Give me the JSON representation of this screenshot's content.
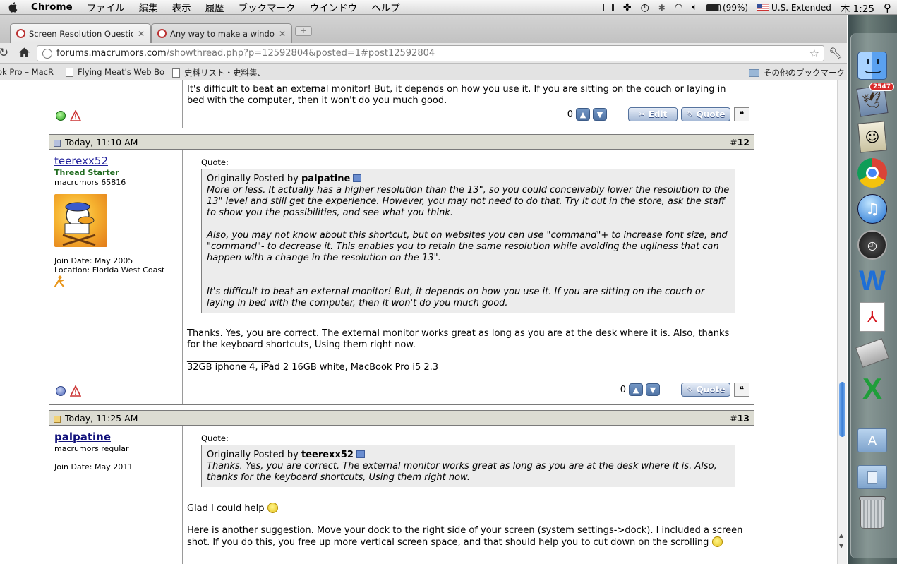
{
  "menubar": {
    "app": "Chrome",
    "items": [
      "ファイル",
      "編集",
      "表示",
      "履歴",
      "ブックマーク",
      "ウインドウ",
      "ヘルプ"
    ],
    "battery": "(99%)",
    "input_source": "U.S. Extended",
    "clock": "木 1:25"
  },
  "tabs": [
    {
      "title": "Screen Resolution Question -",
      "close": "✕"
    },
    {
      "title": "Any way to make a window f",
      "close": "✕"
    }
  ],
  "newtab": "+",
  "address": {
    "domain": "forums.macrumors.com",
    "path": "/showthread.php?p=12592804&posted=1#post12592804"
  },
  "bookmarks": {
    "items": [
      "ok Pro – MacR",
      "Flying Meat's Web Bo",
      "史料リスト・史料集、"
    ],
    "other": "その他のブックマーク"
  },
  "post_prev": {
    "tail_text_1": "It's difficult to beat an external monitor! But, it depends on how you use it. If you are sitting on the couch or laying in",
    "tail_text_2": "bed with the computer, then it won't do you much good.",
    "rep": "0",
    "edit": "Edit",
    "quote": "Quote"
  },
  "post12": {
    "date": "Today, 11:10 AM",
    "number_prefix": "#",
    "number": "12",
    "username": "teerexx52",
    "status": "Thread Starter",
    "rank": "macrumors 65816",
    "join": "Join Date: May 2005",
    "location": "Location: Florida West Coast",
    "quote_label": "Quote:",
    "quote_by_prefix": "Originally Posted by",
    "quote_author": "palpatine",
    "quote_p1": "More or less. It actually has a higher resolution than the 13\", so you could conceivably lower the resolution to the 13\" level and still get the experience. However, you may not need to do that. Try it out in the store, ask the staff to show you the possibilities, and see what you think.",
    "quote_p2": "Also, you may not know about this shortcut, but on websites you can use \"command\"+ to increase font size, and \"command\"- to decrease it. This enables you to retain the same resolution while avoiding the ugliness that can happen with a change in the resolution on the 13\".",
    "quote_p3": "It's difficult to beat an external monitor! But, it depends on how you use it. If you are sitting on the couch or laying in bed with the computer, then it won't do you much good.",
    "body": "Thanks. Yes, you are correct. The external monitor works great as long as you are at the desk where it is. Also, thanks for the keyboard shortcuts, Using them right now.",
    "signature_rule": "__________________",
    "signature": "32GB iphone 4, iPad 2 16GB white, MacBook Pro i5 2.3",
    "rep": "0",
    "quote": "Quote"
  },
  "post13": {
    "date": "Today, 11:25 AM",
    "number_prefix": "#",
    "number": "13",
    "username": "palpatine",
    "rank": "macrumors regular",
    "join": "Join Date: May 2011",
    "quote_label": "Quote:",
    "quote_by_prefix": "Originally Posted by",
    "quote_author": "teerexx52",
    "quote_p1": "Thanks. Yes, you are correct. The external monitor works great as long as you are at the desk where it is. Also, thanks for the keyboard shortcuts, Using them right now.",
    "body1": "Glad I could help",
    "body2": "Here is another suggestion. Move your dock to the right side of your screen (system settings->dock). I included a screen shot. If you do this, you free up more vertical screen space, and that should help you to cut down on the scrolling"
  },
  "dock": {
    "mail_badge": "2547",
    "icons": [
      "finder-icon",
      "mail-icon",
      "preview-icon",
      "chrome-icon",
      "itunes-icon",
      "dashboard-icon",
      "word-icon",
      "pdf-icon",
      "stickies-icon",
      "excel-icon",
      "applications-folder-icon",
      "documents-folder-icon",
      "trash-icon"
    ]
  },
  "colors": {
    "username": "#22229c",
    "thread_starter": "#1f6b1f",
    "post_header": "#dcdcd2",
    "button_blue": "#56739e"
  }
}
